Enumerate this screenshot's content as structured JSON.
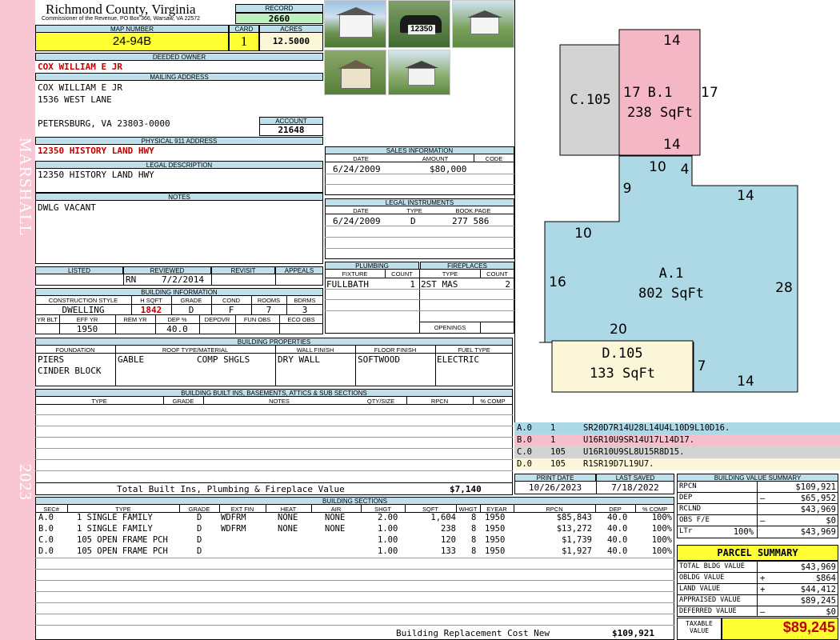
{
  "sidebar": {
    "district": "MARSHALL",
    "year": "2023"
  },
  "header": {
    "county": "Richmond County, Virginia",
    "commissioner": "Commissioner of the Revenue, PO Box 366, Warsaw, VA 22572",
    "record_label": "RECORD",
    "record": "2660",
    "map_label": "MAP NUMBER",
    "map": "24-94B",
    "card_label": "CARD",
    "card": "1",
    "acres_label": "ACRES",
    "acres": "12.5000"
  },
  "owner": {
    "deeded_label": "DEEDED OWNER",
    "deeded": "COX WILLIAM E JR",
    "mailing_label": "MAILING ADDRESS",
    "mail1": "COX WILLIAM E JR",
    "mail2": "1536 WEST LANE",
    "mail3": "PETERSBURG, VA 23803-0000",
    "account_label": "ACCOUNT",
    "account": "21648",
    "physical_label": "PHYSICAL 911 ADDRESS",
    "physical": "12350 HISTORY LAND HWY",
    "legal_label": "LEGAL DESCRIPTION",
    "legal": "12350 HISTORY LAND HWY",
    "notes_label": "NOTES",
    "notes": "DWLG VACANT"
  },
  "photos": {
    "mailbox_number": "12350"
  },
  "sales": {
    "label": "SALES INFORMATION",
    "cols": [
      "DATE",
      "AMOUNT",
      "CODE"
    ],
    "date": "6/24/2009",
    "amount": "$80,000"
  },
  "legal_inst": {
    "label": "LEGAL INSTRUMENTS",
    "cols": [
      "DATE",
      "TYPE",
      "BOOK.PAGE"
    ],
    "date": "6/24/2009",
    "type": "D",
    "book": "277 586"
  },
  "listing": {
    "listed": "LISTED",
    "reviewed": "REVIEWED",
    "revisit": "REVISIT",
    "appeals": "APPEALS",
    "reviewer": "RN",
    "review_date": "7/2/2014"
  },
  "building_info": {
    "label": "BUILDING INFORMATION",
    "cols": [
      "CONSTRUCTION STYLE",
      "H SQFT",
      "GRADE",
      "COND",
      "ROOMS",
      "BDRMS"
    ],
    "style": "DWELLING",
    "hsqft": "1842",
    "grade": "D",
    "cond": "F",
    "rooms": "7",
    "bdrms": "3",
    "cols2": [
      "YR BLT",
      "EFF YR",
      "REM YR",
      "DEP %",
      "DEPOVR",
      "FUN OBS",
      "ECO OBS"
    ],
    "eff_yr": "1950",
    "dep": "40.0"
  },
  "plumbing": {
    "label": "PLUMBING",
    "cols": [
      "FIXTURE",
      "COUNT"
    ],
    "fixture": "FULLBATH",
    "count": "1"
  },
  "fireplaces": {
    "label": "FIREPLACES",
    "cols": [
      "TYPE",
      "COUNT"
    ],
    "type": "2ST MAS",
    "count": "2",
    "openings": "OPENINGS"
  },
  "properties": {
    "label": "BUILDING PROPERTIES",
    "cols": [
      "FOUNDATION",
      "ROOF TYPE/MATERIAL",
      "WALL FINISH",
      "FLOOR FINISH",
      "FUEL TYPE"
    ],
    "found1": "PIERS",
    "found2": "CINDER BLOCK",
    "roof_type": "GABLE",
    "roof_mat": "COMP SHGLS",
    "wall": "DRY WALL",
    "floor": "SOFTWOOD",
    "fuel": "ELECTRIC"
  },
  "builtins": {
    "label": "BUILDING BUILT INS, BASEMENTS, ATTICS & SUB SECTIONS",
    "cols": [
      "TYPE",
      "GRADE",
      "NOTES",
      "QTY/SIZE",
      "RPCN",
      "% COMP"
    ],
    "total_label": "Total Built Ins, Plumbing & Fireplace Value",
    "total": "$7,140"
  },
  "sections": {
    "label": "BUILDING SECTIONS",
    "cols": [
      "SEC#",
      "TYPE",
      "GRADE",
      "EXT FIN",
      "HEAT",
      "AIR",
      "SHGT",
      "SQFT",
      "WHGT",
      "EYEAR",
      "RPCN",
      "DEP",
      "% COMP"
    ],
    "rows": [
      {
        "sec": "A.0",
        "type": "1 SINGLE FAMILY",
        "grade": "D",
        "ext": "WDFRM",
        "heat": "NONE",
        "air": "NONE",
        "shgt": "2.00",
        "sqft": "1,604",
        "whgt": "8",
        "eyear": "1950",
        "rpcn": "$85,843",
        "dep": "40.0",
        "comp": "100%"
      },
      {
        "sec": "B.0",
        "type": "1 SINGLE FAMILY",
        "grade": "D",
        "ext": "WDFRM",
        "heat": "NONE",
        "air": "NONE",
        "shgt": "1.00",
        "sqft": "238",
        "whgt": "8",
        "eyear": "1950",
        "rpcn": "$13,272",
        "dep": "40.0",
        "comp": "100%"
      },
      {
        "sec": "C.0",
        "type": "105 OPEN FRAME PCH",
        "grade": "D",
        "ext": "",
        "heat": "",
        "air": "",
        "shgt": "1.00",
        "sqft": "120",
        "whgt": "8",
        "eyear": "1950",
        "rpcn": "$1,739",
        "dep": "40.0",
        "comp": "100%"
      },
      {
        "sec": "D.0",
        "type": "105 OPEN FRAME PCH",
        "grade": "D",
        "ext": "",
        "heat": "",
        "air": "",
        "shgt": "1.00",
        "sqft": "133",
        "whgt": "8",
        "eyear": "1950",
        "rpcn": "$1,927",
        "dep": "40.0",
        "comp": "100%"
      }
    ],
    "brcn_label": "Building Replacement Cost New",
    "brcn": "$109,921"
  },
  "sketch": {
    "c_label": "C.105",
    "b_label": "B.1",
    "b_area": "238 SqFt",
    "a_label": "A.1",
    "a_area": "802 SqFt",
    "d_label": "D.105",
    "d_area": "133 SqFt",
    "dims": {
      "b_top": "14",
      "b_left": "17",
      "b_right": "17",
      "b_bottom": "14",
      "a_10t": "10",
      "a_4": "4",
      "a_9": "9",
      "a_14r": "14",
      "a_10l": "10",
      "a_16": "16",
      "a_28": "28",
      "a_20": "20",
      "d_7": "7",
      "d_14": "14"
    },
    "colors": {
      "a": "#add8e6",
      "b": "#f5b7c5",
      "c": "#d3d3d3",
      "d": "#fbf6d8"
    }
  },
  "vectors": [
    {
      "sec": "A.0",
      "code": "1",
      "path": "SR20D7R14U28L14U4L10D9L10D16.",
      "color": "#add8e6"
    },
    {
      "sec": "B.0",
      "code": "1",
      "path": "U16R10U9SR14U17L14D17.",
      "color": "#f7bfcc"
    },
    {
      "sec": "C.0",
      "code": "105",
      "path": "U16R10U9SL8U15R8D15.",
      "color": "#d3d3d3"
    },
    {
      "sec": "D.0",
      "code": "105",
      "path": "R1SR19D7L19U7.",
      "color": "#fbf6d8"
    }
  ],
  "dates": {
    "print_label": "PRINT DATE",
    "print": "10/26/2023",
    "saved_label": "LAST SAVED",
    "saved": "7/18/2022"
  },
  "value_summary": {
    "label": "BUILDING VALUE SUMMARY",
    "rpcn_label": "RPCN",
    "rpcn": "$109,921",
    "dep_label": "DEP",
    "dep_sign": "–",
    "dep": "$65,952",
    "rclnd_label": "RCLND",
    "rclnd": "$43,969",
    "obs_label": "OBS F/E",
    "obs_sign": "–",
    "obs": "$0",
    "ltr_label": "LTr",
    "ltr_pct": "100%",
    "ltr": "$43,969"
  },
  "parcel": {
    "label": "PARCEL SUMMARY",
    "tbv_label": "TOTAL BLDG VALUE",
    "tbv": "$43,969",
    "obv_label": "OBLDG VALUE",
    "obv_sign": "+",
    "obv": "$864",
    "land_label": "LAND VALUE",
    "land_sign": "+",
    "land": "$44,412",
    "appr_label": "APPRAISED VALUE",
    "appr": "$89,245",
    "def_label": "DEFERRED VALUE",
    "def_sign": "–",
    "def": "$0",
    "taxable_label1": "TAXABLE",
    "taxable_label2": "VALUE",
    "taxable": "$89,245"
  }
}
